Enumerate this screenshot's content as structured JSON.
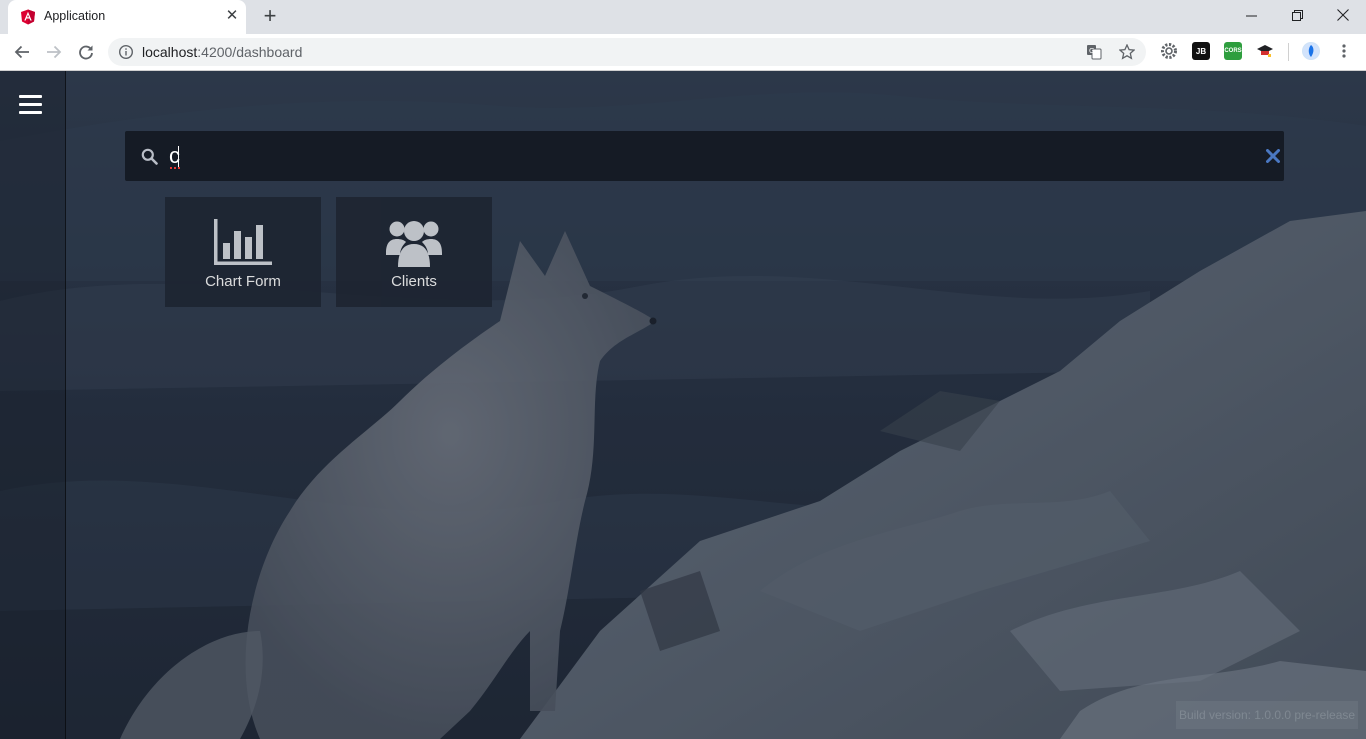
{
  "browser": {
    "tab_title": "Application",
    "tab_favicon": "angular-icon",
    "url_host": "localhost",
    "url_path": ":4200/dashboard",
    "extensions": [
      "settings-gear-icon",
      "jetbrains-icon",
      "cors-icon",
      "graduation-cap-icon"
    ],
    "ext_jb_label": "JB",
    "ext_cors_label": "CORS"
  },
  "app": {
    "search": {
      "value": "c",
      "placeholder": ""
    },
    "results": [
      {
        "label": "Chart Form",
        "icon": "bar-chart-icon"
      },
      {
        "label": "Clients",
        "icon": "users-icon"
      }
    ],
    "build_version": "Build version: 1.0.0.0 pre-release"
  },
  "colors": {
    "accent": "#4a78c2",
    "search_bg": "#151b25",
    "tile_bg": "#1e2532"
  }
}
